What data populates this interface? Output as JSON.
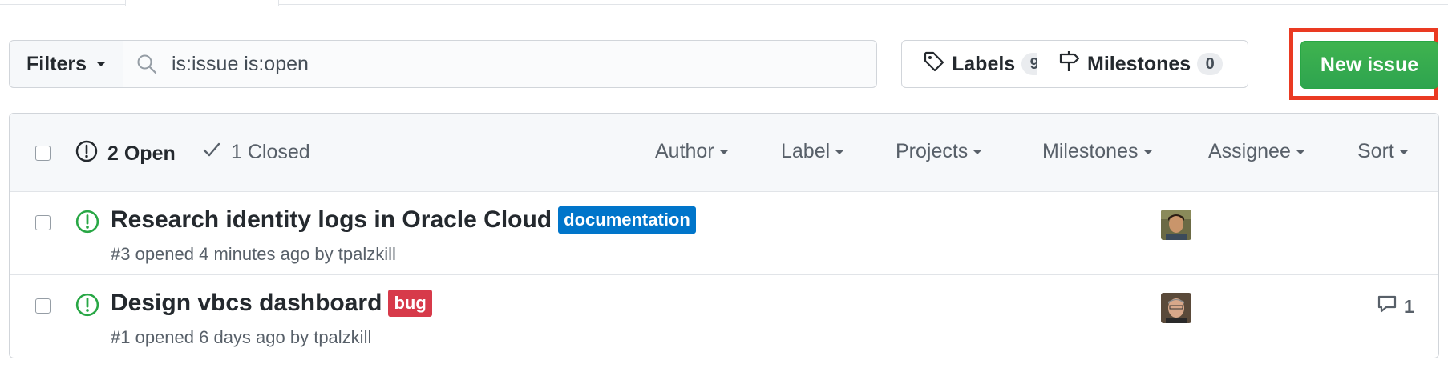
{
  "toolbar": {
    "filters_label": "Filters",
    "search_value": "is:issue is:open",
    "labels_label": "Labels",
    "labels_count": "9",
    "milestones_label": "Milestones",
    "milestones_count": "0",
    "new_issue_label": "New issue"
  },
  "header": {
    "open_label": "2 Open",
    "closed_label": "1 Closed",
    "menus": {
      "author": "Author",
      "label": "Label",
      "projects": "Projects",
      "milestones": "Milestones",
      "assignee": "Assignee",
      "sort": "Sort"
    }
  },
  "issues": [
    {
      "title": "Research identity logs in Oracle Cloud",
      "label": "documentation",
      "label_color": "#0075ca",
      "meta": "#3 opened 4 minutes ago by tpalzkill",
      "comments": ""
    },
    {
      "title": "Design vbcs dashboard",
      "label": "bug",
      "label_color": "#d73a4a",
      "meta": "#1 opened 6 days ago by tpalzkill",
      "comments": "1"
    }
  ],
  "colors": {
    "open_icon": "#28a745",
    "primary_button": "#2ea44f",
    "highlight": "#ea3a22"
  }
}
